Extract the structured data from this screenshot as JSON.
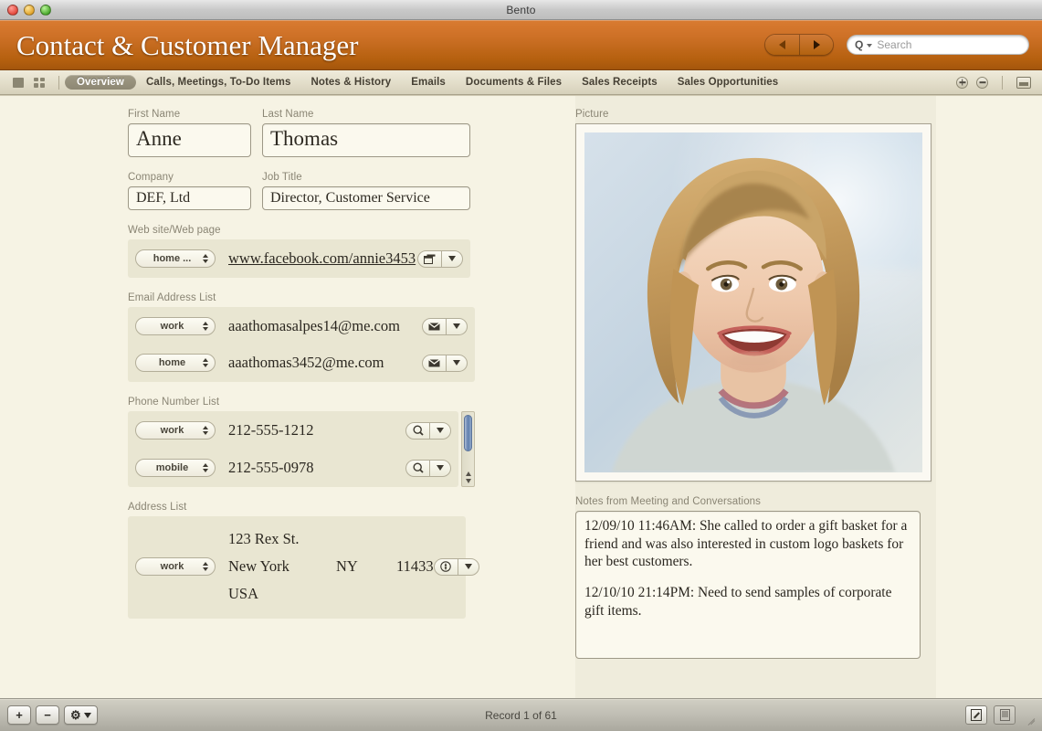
{
  "window": {
    "title": "Bento"
  },
  "header": {
    "brand_title": "Contact & Customer Manager",
    "nav_back_icon": "arrow-left-icon",
    "nav_forward_icon": "arrow-right-icon",
    "search_placeholder": "Search",
    "search_value": "",
    "accent_color": "#c06a1a"
  },
  "tabbar": {
    "view_form_icon": "form-view-icon",
    "view_grid_icon": "grid-view-icon",
    "tabs": [
      {
        "label": "Overview",
        "active": true
      },
      {
        "label": "Calls, Meetings, To-Do Items",
        "active": false
      },
      {
        "label": "Notes & History",
        "active": false
      },
      {
        "label": "Emails",
        "active": false
      },
      {
        "label": "Documents & Files",
        "active": false
      },
      {
        "label": "Sales Receipts",
        "active": false
      },
      {
        "label": "Sales Opportunities",
        "active": false
      }
    ],
    "add_field_icon": "plus-circle-icon",
    "remove_field_icon": "minus-circle-icon",
    "panel_icon": "panel-toggle-icon"
  },
  "form": {
    "first_name": {
      "label": "First Name",
      "value": "Anne"
    },
    "last_name": {
      "label": "Last Name",
      "value": "Thomas"
    },
    "company": {
      "label": "Company",
      "value": "DEF, Ltd"
    },
    "job_title": {
      "label": "Job Title",
      "value": "Director, Customer Service"
    },
    "website": {
      "label": "Web site/Web page",
      "rows": [
        {
          "type": "home ...",
          "value": "www.facebook.com/annie3453",
          "action_icon": "browser-window-icon"
        }
      ]
    },
    "email": {
      "label": "Email Address List",
      "rows": [
        {
          "type": "work",
          "value": "aaathomasalpes14@me.com",
          "action_icon": "envelope-icon"
        },
        {
          "type": "home",
          "value": "aaathomas3452@me.com",
          "action_icon": "envelope-icon"
        }
      ]
    },
    "phone": {
      "label": "Phone Number List",
      "rows": [
        {
          "type": "work",
          "value": "212-555-1212",
          "action_icon": "magnifier-icon"
        },
        {
          "type": "mobile",
          "value": "212-555-0978",
          "action_icon": "magnifier-icon"
        }
      ]
    },
    "address": {
      "label": "Address List",
      "type": "work",
      "street": "123 Rex St.",
      "city": "New York",
      "state": "NY",
      "zip": "11433",
      "country": "USA",
      "action_icon": "compass-icon"
    }
  },
  "picture": {
    "label": "Picture"
  },
  "notes": {
    "label": "Notes from Meeting and Conversations",
    "paragraphs": [
      "12/09/10 11:46AM: She called to order a gift basket for a friend and was also interested in custom logo baskets for her best customers.",
      "12/10/10 21:14PM:  Need to send samples of corporate gift items."
    ]
  },
  "statusbar": {
    "add_label": "+",
    "remove_label": "−",
    "gear_label": "⚙",
    "record_text": "Record 1 of 61",
    "edit_icon": "edit-form-icon",
    "fullscreen_icon": "fullscreen-icon"
  }
}
